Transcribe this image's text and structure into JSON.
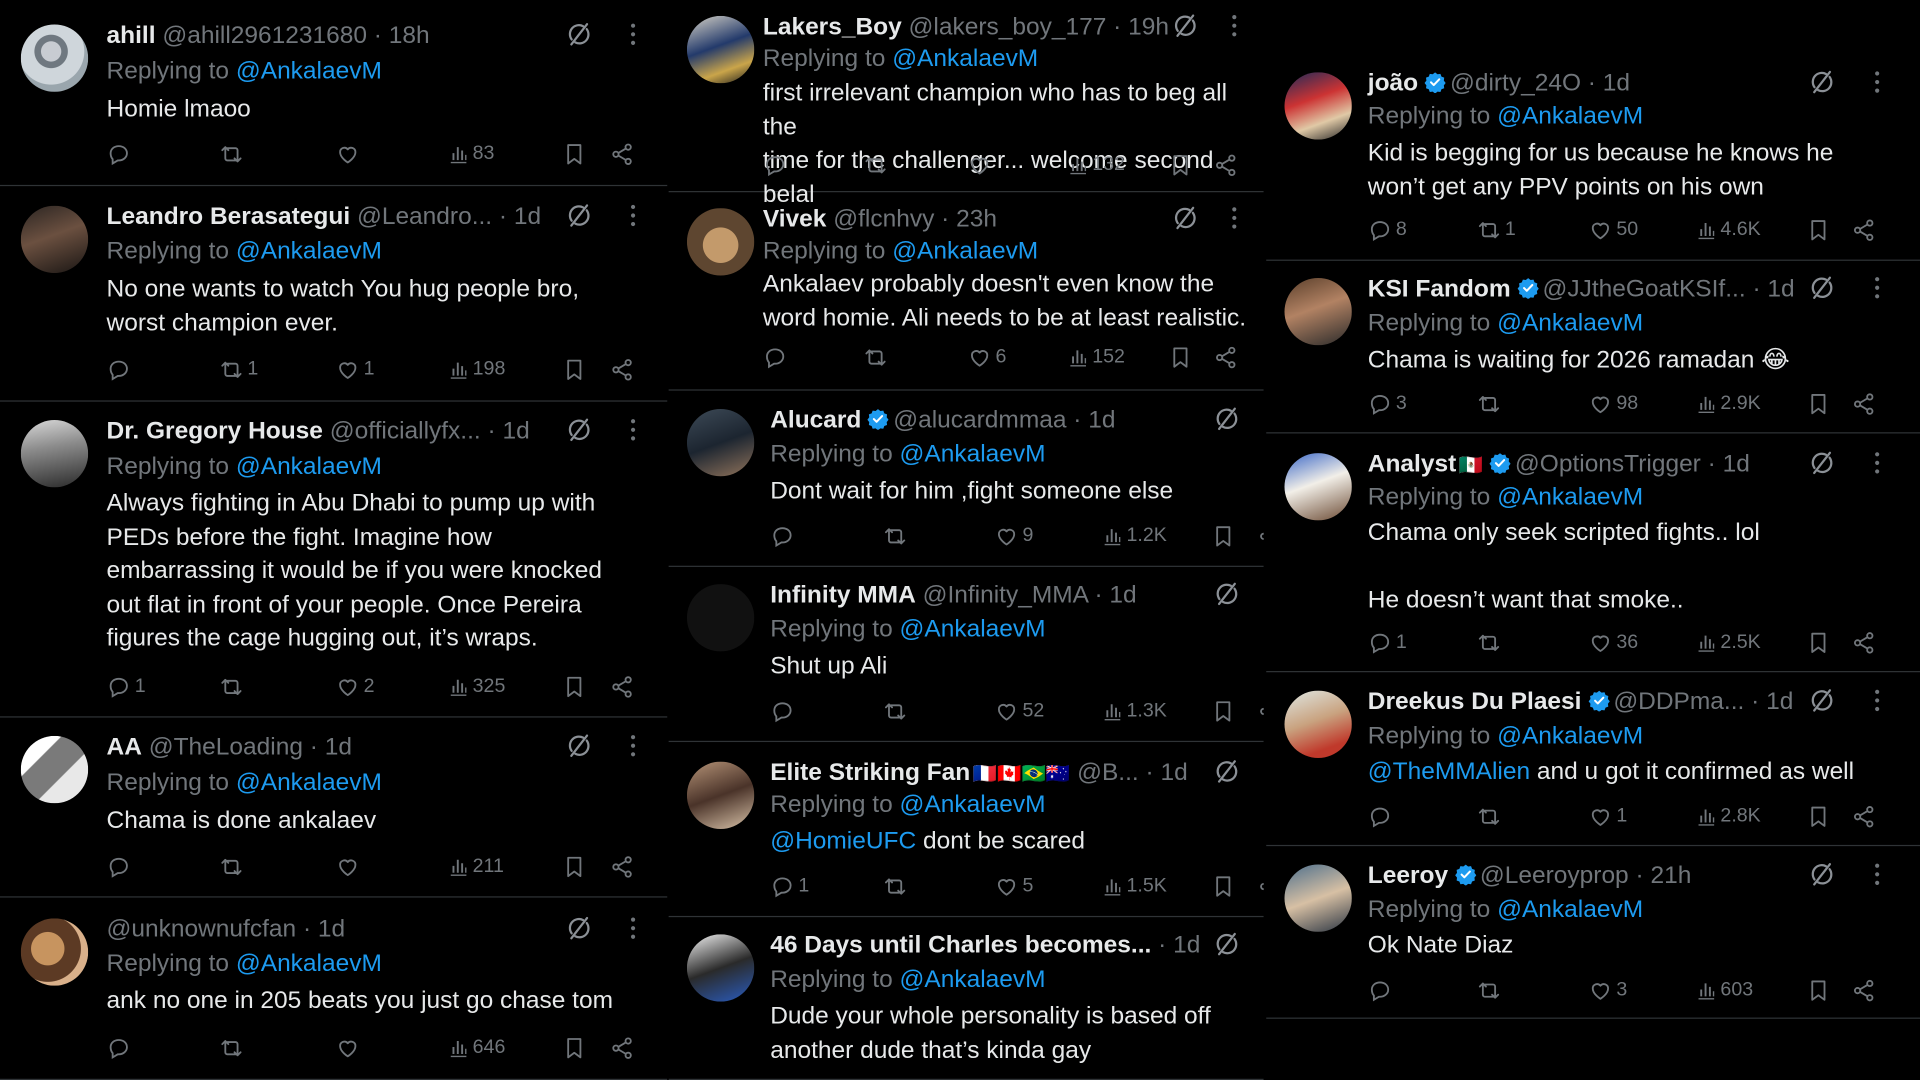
{
  "replying_prefix": "Replying to",
  "reply_target": "@AnkalaevM",
  "colors": {
    "background": "#000000",
    "text": "#e7e9ea",
    "muted": "#71767b",
    "accent": "#1d9bf0",
    "divider": "#2f3336",
    "verified": "#1d9bf0"
  },
  "icons": [
    "reply-icon",
    "retweet-icon",
    "like-icon",
    "views-icon",
    "bookmark-icon",
    "share-icon",
    "grok-icon",
    "more-icon",
    "verified-badge-icon"
  ],
  "columns": [
    {
      "tweets": [
        {
          "name": "ahill",
          "handle": "@ahill2961231680",
          "time": "18h",
          "verified": false,
          "text": "Homie lmaoo",
          "replies": "",
          "retweets": "",
          "likes": "",
          "views": "83"
        },
        {
          "name": "Leandro Berasategui",
          "handle": "@Leandro...",
          "time": "1d",
          "verified": false,
          "text": "No one wants to watch You hug people bro,\nworst champion ever.",
          "replies": "",
          "retweets": "1",
          "likes": "1",
          "views": "198"
        },
        {
          "name": "Dr. Gregory House",
          "handle": "@officiallyfx...",
          "time": "1d",
          "verified": false,
          "text": "Always fighting in Abu Dhabi to pump up with\nPEDs before the fight. Imagine how\nembarrassing it would be if you were knocked\nout flat in front of your people. Once Pereira\nfigures the cage hugging out, it’s wraps.",
          "replies": "1",
          "retweets": "",
          "likes": "2",
          "views": "325"
        },
        {
          "name": "AA",
          "handle": "@TheLoading",
          "time": "1d",
          "verified": false,
          "text": "Chama is done ankalaev",
          "replies": "",
          "retweets": "",
          "likes": "",
          "views": "211"
        },
        {
          "name": "",
          "handle": "@unknownufcfan",
          "time": "1d",
          "verified": false,
          "text": "ank no one in 205 beats you just go chase tom",
          "replies": "",
          "retweets": "",
          "likes": "",
          "views": "646"
        }
      ]
    },
    {
      "tweets": [
        {
          "name": "Lakers_Boy",
          "handle": "@lakers_boy_177",
          "time": "19h",
          "verified": false,
          "text": "first irrelevant champion who has to beg all the\ntime for the challenger... welcome second belal",
          "replies": "",
          "retweets": "",
          "likes": "",
          "views": "132"
        },
        {
          "name": "Vivek",
          "handle": "@flcnhvy",
          "time": "23h",
          "verified": false,
          "text": "Ankalaev probably doesn't even know the\nword homie. Ali needs to be at least realistic.",
          "replies": "",
          "retweets": "",
          "likes": "6",
          "views": "152"
        },
        {
          "name": "Alucard",
          "handle": "@alucardmmaa",
          "time": "1d",
          "verified": true,
          "text": "Dont wait for him ,fight someone else",
          "replies": "",
          "retweets": "",
          "likes": "9",
          "views": "1.2K"
        },
        {
          "name": "Infinity MMA",
          "handle": "@Infinity_MMA",
          "time": "1d",
          "verified": false,
          "text": "Shut up Ali",
          "replies": "",
          "retweets": "",
          "likes": "52",
          "views": "1.3K"
        },
        {
          "name": "Elite Striking Fan",
          "flags": "🇫🇷🇨🇦🇧🇷🇦🇺",
          "handle": "@B...",
          "time": "1d",
          "verified": false,
          "mention": "@HomieUFC",
          "text": " dont be scared",
          "replies": "1",
          "retweets": "",
          "likes": "5",
          "views": "1.5K"
        },
        {
          "name": "46 Days until Charles becomes...",
          "handle": "",
          "time": "1d",
          "verified": false,
          "text": "Dude your whole personality is based off\nanother dude that’s kinda gay",
          "replies": "",
          "retweets": "",
          "likes": "",
          "views": ""
        }
      ]
    },
    {
      "tweets": [
        {
          "name": "joão",
          "handle": "@dirty_24O",
          "time": "1d",
          "verified": true,
          "text": "Kid is begging for us because he knows he\nwon’t get any PPV points on his own",
          "replies": "8",
          "retweets": "1",
          "likes": "50",
          "views": "4.6K"
        },
        {
          "name": "KSI Fandom",
          "handle": "@JJtheGoatKSIf...",
          "time": "1d",
          "verified": true,
          "text": "Chama is waiting for 2026 ramadan 😂",
          "replies": "3",
          "retweets": "",
          "likes": "98",
          "views": "2.9K"
        },
        {
          "name": "Analyst",
          "flags": "🇲🇽",
          "handle": "@OptionsTrigger",
          "time": "1d",
          "verified": true,
          "text": "Chama only seek scripted fights.. lol\n\nHe doesn’t want that smoke..",
          "replies": "1",
          "retweets": "",
          "likes": "36",
          "views": "2.5K"
        },
        {
          "name": "Dreekus Du Plaesi",
          "handle": "@DDPma...",
          "time": "1d",
          "verified": true,
          "mention": "@TheMMAlien",
          "text": " and u got it confirmed as well",
          "replies": "",
          "retweets": "",
          "likes": "1",
          "views": "2.8K"
        },
        {
          "name": "Leeroy",
          "handle": "@Leeroyprop",
          "time": "21h",
          "verified": true,
          "text": "Ok Nate Diaz",
          "replies": "",
          "retweets": "",
          "likes": "3",
          "views": "603"
        }
      ]
    }
  ]
}
